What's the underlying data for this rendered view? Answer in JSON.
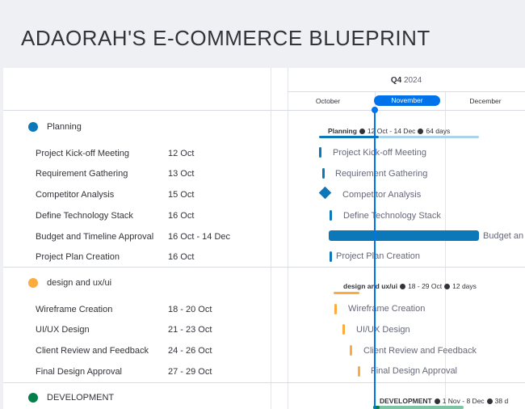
{
  "page": {
    "title": "ADAORAH'S E-COMMERCE BLUEPRINT"
  },
  "timeline": {
    "quarter": "Q4",
    "year": "2024",
    "months": [
      "October",
      "November",
      "December"
    ],
    "current_month": "November"
  },
  "colors": {
    "planning": "#0073ea",
    "planning_bar": "#0d78b9",
    "design": "#fdab3d",
    "development": "#037f4c",
    "today": "#0073ea"
  },
  "groups": [
    {
      "name": "Planning",
      "summary_name": "Planning",
      "summary_range": "12 Oct - 14 Dec",
      "summary_duration": "64 days",
      "tasks": [
        {
          "name": "Project Kick-off Meeting",
          "date": "12 Oct"
        },
        {
          "name": "Requirement Gathering",
          "date": "13 Oct"
        },
        {
          "name": "Competitor Analysis",
          "date": "15 Oct"
        },
        {
          "name": "Define Technology Stack",
          "date": "16 Oct"
        },
        {
          "name": "Budget and Timeline Approval",
          "date": "16 Oct - 14 Dec",
          "label_visible": "Budget an"
        },
        {
          "name": "Project Plan Creation",
          "date": "16 Oct"
        }
      ]
    },
    {
      "name": "design and ux/ui",
      "summary_name": "design and ux/ui",
      "summary_range": "18 - 29 Oct",
      "summary_duration": "12 days",
      "tasks": [
        {
          "name": "Wireframe Creation",
          "date": "18 - 20 Oct"
        },
        {
          "name": "UI/UX Design",
          "date": "21 - 23 Oct"
        },
        {
          "name": "Client Review and Feedback",
          "date": "24 - 26 Oct"
        },
        {
          "name": "Final Design Approval",
          "date": "27 - 29 Oct"
        }
      ]
    },
    {
      "name": "DEVELOPMENT",
      "summary_name": "DEVELOPMENT",
      "summary_range": "1 Nov - 8 Dec",
      "summary_duration": "38 d"
    }
  ]
}
